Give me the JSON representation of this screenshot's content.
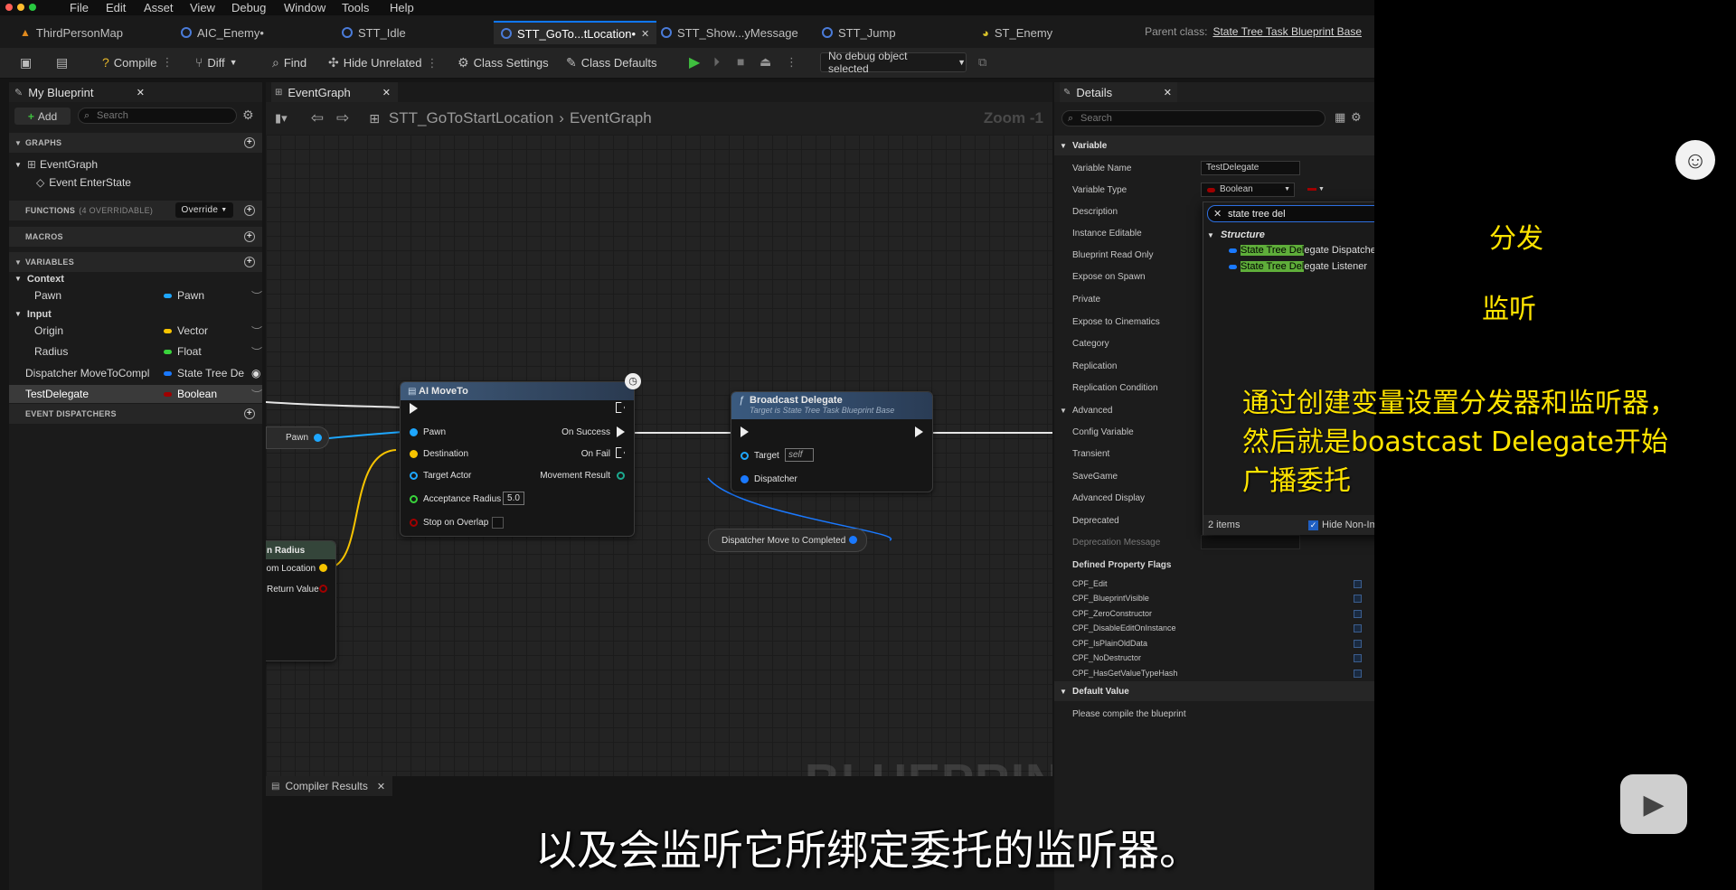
{
  "menubar": {
    "items": [
      "File",
      "Edit",
      "Asset",
      "View",
      "Debug",
      "Window",
      "Tools",
      "Help"
    ]
  },
  "tabs": [
    {
      "label": "ThirdPersonMap"
    },
    {
      "label": "AIC_Enemy•"
    },
    {
      "label": "STT_Idle"
    },
    {
      "label": "STT_GoTo...tLocation•"
    },
    {
      "label": "STT_Show...yMessage"
    },
    {
      "label": "STT_Jump"
    },
    {
      "label": "ST_Enemy"
    }
  ],
  "parent_class": {
    "label": "Parent class:",
    "value": "State Tree Task Blueprint Base"
  },
  "toolbar": {
    "compile": "Compile",
    "diff": "Diff",
    "find": "Find",
    "hide_unrelated": "Hide Unrelated",
    "class_settings": "Class Settings",
    "class_defaults": "Class Defaults",
    "debug_object": "No debug object selected"
  },
  "my_blueprint": {
    "title": "My Blueprint",
    "add": "Add",
    "search_placeholder": "Search",
    "graphs_header": "GRAPHS",
    "event_graph": "EventGraph",
    "event_enter_state": "Event EnterState",
    "functions_header": "FUNCTIONS",
    "functions_count": "(4 OVERRIDABLE)",
    "override": "Override",
    "macros_header": "MACROS",
    "variables_header": "VARIABLES",
    "context_header": "Context",
    "input_header": "Input",
    "variables": [
      {
        "name": "Pawn",
        "type": "Pawn",
        "color": "#1ea7ff"
      },
      {
        "name": "Origin",
        "type": "Vector",
        "color": "#f7c400"
      },
      {
        "name": "Radius",
        "type": "Float",
        "color": "#39d33c"
      },
      {
        "name": "Dispatcher MoveToCompl",
        "type": "State Tree Del",
        "color": "#1a79ff"
      },
      {
        "name": "TestDelegate",
        "type": "Boolean",
        "color": "#a00000"
      }
    ],
    "event_dispatchers_header": "EVENT DISPATCHERS"
  },
  "graph": {
    "tab": "EventGraph",
    "breadcrumb_root": "STT_GoToStartLocation",
    "breadcrumb_leaf": "EventGraph",
    "zoom": "Zoom -1",
    "watermark": "BLUEPRINT",
    "pawn_node": "Pawn",
    "radius_node_title": "n Radius",
    "radius_node_out1": "dom Location",
    "radius_node_out2": "Return Value",
    "ai_moveto": {
      "title": "AI MoveTo",
      "pins_in": [
        "Pawn",
        "Destination",
        "Target Actor",
        "Acceptance Radius",
        "Stop on Overlap"
      ],
      "acceptance_value": "5.0",
      "pins_out": [
        "On Success",
        "On Fail",
        "Movement Result"
      ]
    },
    "broadcast": {
      "title": "Broadcast Delegate",
      "subtitle": "Target is State Tree Task Blueprint Base",
      "target": "Target",
      "target_value": "self",
      "dispatcher": "Dispatcher"
    },
    "dispatcher_node": "Dispatcher Move to Completed"
  },
  "compiler_results": "Compiler Results",
  "details": {
    "title": "Details",
    "search_placeholder": "Search",
    "variable_header": "Variable",
    "rows": [
      "Variable Name",
      "Variable Type",
      "Description",
      "Instance Editable",
      "Blueprint Read Only",
      "Expose on Spawn",
      "Private",
      "Expose to Cinematics",
      "Category",
      "Replication",
      "Replication Condition"
    ],
    "variable_name_value": "TestDelegate",
    "variable_type_value": "Boolean",
    "advanced_header": "Advanced",
    "advanced_rows": [
      "Config Variable",
      "Transient",
      "SaveGame",
      "Advanced Display",
      "Deprecated",
      "Deprecation Message"
    ],
    "flags_header": "Defined Property Flags",
    "flags": [
      "CPF_Edit",
      "CPF_BlueprintVisible",
      "CPF_ZeroConstructor",
      "CPF_DisableEditOnInstance",
      "CPF_IsPlainOldData",
      "CPF_NoDestructor",
      "CPF_HasGetValueTypeHash"
    ],
    "default_value_header": "Default Value",
    "default_value_note": "Please compile the blueprint"
  },
  "type_picker": {
    "search_value": "state tree del",
    "category": "Structure",
    "items": [
      {
        "match": "State Tree Del",
        "rest": "egate Dispatcher"
      },
      {
        "match": "State Tree Del",
        "rest": "egate Listener"
      }
    ],
    "count": "2 items",
    "hide_non_imported": "Hide Non-Imported Types"
  },
  "annotations": {
    "dispatcher": "分发",
    "listener": "监听",
    "note_line1": "通过创建变量设置分发器和监听器，",
    "note_line2": "然后就是boastcast Delegate开始",
    "note_line3": "广播委托",
    "arrow_color": "#ffe400"
  },
  "subtitle": "以及会监听它所绑定委托的监听器。"
}
